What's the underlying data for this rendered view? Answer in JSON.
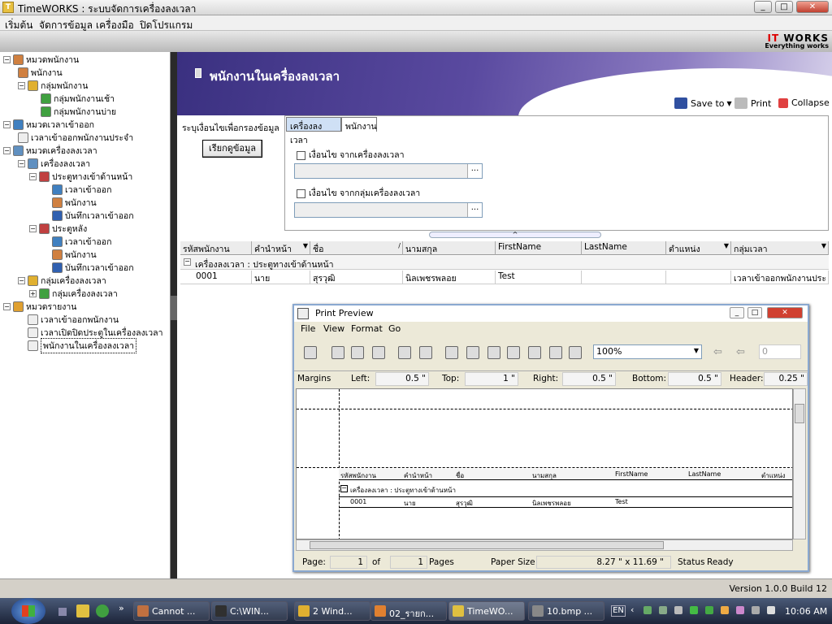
{
  "window": {
    "title": "TimeWORKS : ระบบจัดการเครื่องลงเวลา",
    "controls": {
      "minimize": "_",
      "maximize": "□",
      "close": "✕"
    }
  },
  "menu": [
    "เริ่มต้น",
    "จัดการข้อมูล",
    "เครื่องมือ",
    "ปิดโปรแกรม"
  ],
  "logo": {
    "brand_it": "IT",
    "brand_works": "WORKS",
    "tagline": "Everything works"
  },
  "sidebar": {
    "items": [
      {
        "label": "หมวดพนักงาน",
        "icon": "people-icon"
      },
      {
        "label": "พนักงาน",
        "icon": "people-icon"
      },
      {
        "label": "กลุ่มพนักงาน",
        "icon": "folder-icon"
      },
      {
        "label": "กลุ่มพนักงานเช้า",
        "icon": "group-icon"
      },
      {
        "label": "กลุ่มพนักงานบ่าย",
        "icon": "group-icon"
      },
      {
        "label": "หมวดเวลาเข้าออก",
        "icon": "clock-icon"
      },
      {
        "label": "เวลาเข้าออกพนักงานประจำ",
        "icon": "document-icon"
      },
      {
        "label": "หมวดเครื่องลงเวลา",
        "icon": "device-icon"
      },
      {
        "label": "เครื่องลงเวลา",
        "icon": "device-icon"
      },
      {
        "label": "ประตูทางเข้าด้านหน้า",
        "icon": "door-icon"
      },
      {
        "label": "เวลาเข้าออก",
        "icon": "clock-icon"
      },
      {
        "label": "พนักงาน",
        "icon": "people-icon"
      },
      {
        "label": "บันทึกเวลาเข้าออก",
        "icon": "edit-icon"
      },
      {
        "label": "ประตูหลัง",
        "icon": "door-icon"
      },
      {
        "label": "เวลาเข้าออก",
        "icon": "clock-icon"
      },
      {
        "label": "พนักงาน",
        "icon": "people-icon"
      },
      {
        "label": "บันทึกเวลาเข้าออก",
        "icon": "edit-icon"
      },
      {
        "label": "กลุ่มเครื่องลงเวลา",
        "icon": "folder-icon"
      },
      {
        "label": "กลุ่มเครื่องลงเวลา",
        "icon": "group-icon"
      },
      {
        "label": "หมวดรายงาน",
        "icon": "report-icon"
      },
      {
        "label": "เวลาเข้าออกพนักงาน",
        "icon": "document-icon"
      },
      {
        "label": "เวลาเปิดปิดประตูในเครื่องลงเวลา",
        "icon": "document-icon"
      },
      {
        "label": "พนักงานในเครื่องลงเวลา",
        "icon": "document-icon"
      }
    ]
  },
  "header": {
    "title": "พนักงานในเครื่องลงเวลา"
  },
  "toolbar": {
    "save_to": "Save to",
    "print": "Print",
    "collapse": "Collapse"
  },
  "filter": {
    "label": "ระบุเงื่อนไขเพื่อกรองข้อมูล",
    "fetch_button": "เรียกดูข้อมูล",
    "tabs": [
      "เครื่องลงเวลา",
      "พนักงาน"
    ],
    "cond1": "เงื่อนไข จากเครื่องลงเวลา",
    "cond2": "เงื่อนไข จากกลุ่มเครื่องลงเวลา",
    "dots": "..."
  },
  "grid": {
    "columns": [
      "รหัสพนักงาน",
      "คำนำหน้า",
      "ชื่อ",
      "นามสกุล",
      "FirstName",
      "LastName",
      "ตำแหน่ง",
      "กลุ่มเวลา"
    ],
    "group_label": "เครื่องลงเวลา : ประตูทางเข้าด้านหน้า",
    "rows": [
      [
        "0001",
        "นาย",
        "สุรวุฒิ",
        "นิลเพชรพลอย",
        "Test",
        "",
        "",
        "เวลาเข้าออกพนักงานประ"
      ]
    ]
  },
  "print_preview": {
    "title": "Print Preview",
    "menu": [
      "File",
      "View",
      "Format",
      "Go"
    ],
    "zoom": "100%",
    "page_input": "0",
    "margins_label": "Margins",
    "left_label": "Left:",
    "left": "0.5 \"",
    "top_label": "Top:",
    "top": "1 \"",
    "right_label": "Right:",
    "right": "0.5 \"",
    "bottom_label": "Bottom:",
    "bottom": "0.5 \"",
    "header_label": "Header:",
    "header": "0.25 \"",
    "preview_columns": [
      "รหัสพนักงาน",
      "คำนำหน้า",
      "ชื่อ",
      "นามสกุล",
      "FirstName",
      "LastName",
      "ตำแหน่ง"
    ],
    "preview_group": "เครื่องลงเวลา : ประตูทางเข้าด้านหน้า",
    "preview_row": [
      "0001",
      "นาย",
      "สุรวุฒิ",
      "นิลเพชรพลอย",
      "Test",
      "",
      ""
    ],
    "page_label": "Page:",
    "page": "1",
    "of_label": "of",
    "pages": "1",
    "pages_label": "Pages",
    "paper_label": "Paper Size",
    "paper": "8.27 \" x 11.69 \"",
    "status_label": "Status",
    "status": "Ready"
  },
  "statusbar": {
    "version": "Version 1.0.0 Build 12"
  },
  "taskbar": {
    "tasks": [
      "Cannot ...",
      "C:\\WIN...",
      "2 Wind...",
      "02_รายก...",
      "TimeWO...",
      "10.bmp ..."
    ],
    "lang": "EN",
    "time": "10:06 AM"
  },
  "colors": {
    "header_start": "#3a3080",
    "accent": "#5a4aa0",
    "logo_red": "#dd0000"
  }
}
